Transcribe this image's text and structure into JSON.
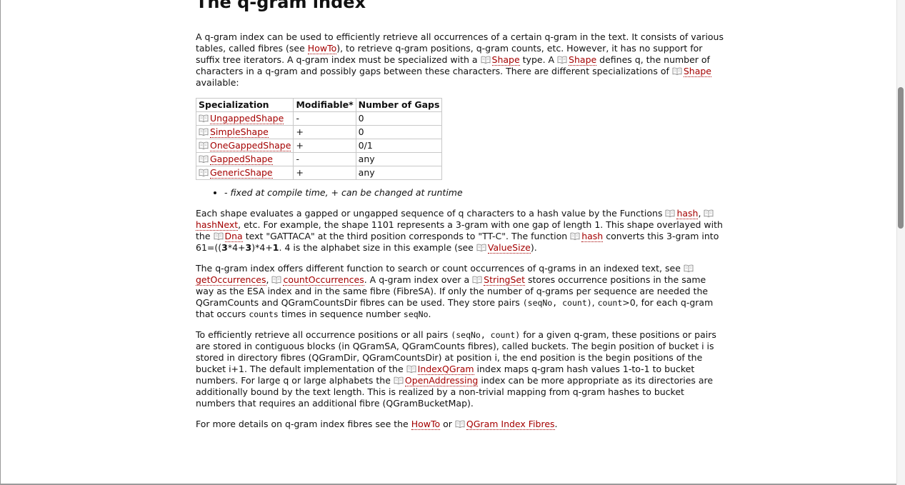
{
  "title": "The q-gram index",
  "p1": {
    "t1": "A q-gram index can be used to efficiently retrieve all occurrences of a certain q-gram in the text. It consists of various tables, called fibres (see ",
    "link_howto": "HowTo",
    "t2": "), to retrieve q-gram positions, q-gram counts, etc. However, it has no support for suffix tree iterators. A q-gram index must be specialized with a ",
    "link_shape1": "Shape",
    "t3": " type. A ",
    "link_shape2": "Shape",
    "t4": " defines q, the number of characters in a q-gram and possibly gaps between these characters. There are different specializations of ",
    "link_shape3": "Shape",
    "t5": " available:"
  },
  "table": {
    "headers": [
      "Specialization",
      "Modifiable*",
      "Number of Gaps"
    ],
    "rows": [
      {
        "name": "UngappedShape",
        "modifiable": "-",
        "gaps": "0"
      },
      {
        "name": "SimpleShape",
        "modifiable": "+",
        "gaps": "0"
      },
      {
        "name": "OneGappedShape",
        "modifiable": "+",
        "gaps": "0/1"
      },
      {
        "name": "GappedShape",
        "modifiable": "-",
        "gaps": "any"
      },
      {
        "name": "GenericShape",
        "modifiable": "+",
        "gaps": "any"
      }
    ]
  },
  "note": "- fixed at compile time, + can be changed at runtime",
  "p2": {
    "t1": "Each shape evaluates a gapped or ungapped sequence of q characters to a hash value by the Functions ",
    "link_hash": "hash",
    "t2": ", ",
    "link_hashnext": "hashNext",
    "t3": ", etc. For example, the shape 1101 represents a 3-gram with one gap of length 1. This shape overlayed with the ",
    "link_dna": "Dna",
    "t4": " text \"GATTACA\" at the third position corresponds to \"TT-C\". The function ",
    "link_hash2": "hash",
    "t5": " converts this 3-gram into 61=((",
    "b1": "3",
    "t6": "*4+",
    "b2": "3",
    "t7": ")*4+",
    "b3": "1",
    "t8": ". 4 is the alphabet size in this example (see ",
    "link_valuesize": "ValueSize",
    "t9": ")."
  },
  "p3": {
    "t1": "The q-gram index offers different function to search or count occurrences of q-grams in an indexed text, see ",
    "link_getocc": "getOccurrences",
    "t2": ", ",
    "link_countocc": "countOccurrences",
    "t3": ". A q-gram index over a ",
    "link_stringset": "StringSet",
    "t4": " stores occurrence positions in the same way as the ESA index and in the same fibre (FibreSA). If only the number of q-grams per sequence are needed the QGramCounts and QGramCountsDir fibres can be used. They store pairs ",
    "c1": "(seqNo, count)",
    "t5": ", ",
    "c2": "count",
    "t6": ">0, for each q-gram that occurs ",
    "c3": "counts",
    "t7": " times in sequence number ",
    "c4": "seqNo",
    "t8": "."
  },
  "p4": {
    "t1": "To efficiently retrieve all occurrence positions or all pairs ",
    "c1": "(seqNo, count)",
    "t2": " for a given q-gram, these positions or pairs are stored in contiguous blocks (in QGramSA, QGramCounts fibres), called buckets. The begin position of bucket i is stored in directory fibres (QGramDir, QGramCountsDir) at position i, the end position is the begin positions of the bucket i+1. The default implementation of the ",
    "link_indexqgram": "IndexQGram",
    "t3": " index maps q-gram hash values 1-to-1 to bucket numbers. For large q or large alphabets the ",
    "link_openaddr": "OpenAddressing",
    "t4": " index can be more appropriate as its directories are additionally bound by the text length. This is realized by a non-trivial mapping from q-gram hashes to bucket numbers that requires an additional fibre (QGramBucketMap)."
  },
  "p5": {
    "t1": "For more details on q-gram index fibres see the ",
    "link_howto": "HowTo",
    "t2": " or ",
    "link_fibres": "QGram Index Fibres",
    "t3": "."
  },
  "icons": {
    "link": "book-icon"
  },
  "colors": {
    "link": "#a40000",
    "text": "#111111",
    "border": "#c8c8c8"
  }
}
